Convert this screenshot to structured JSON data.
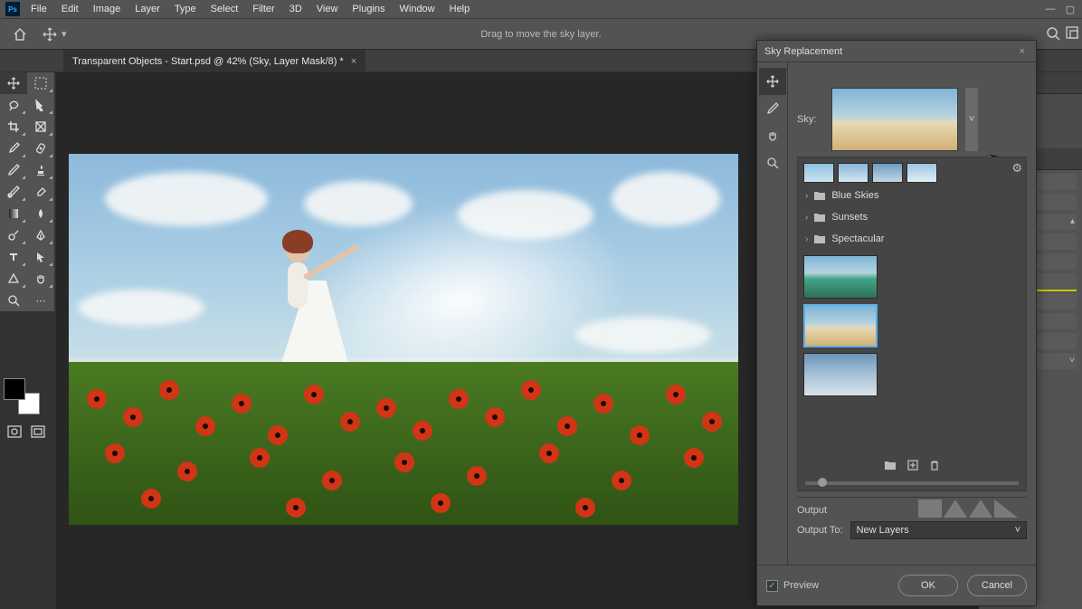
{
  "menubar": {
    "items": [
      "File",
      "Edit",
      "Image",
      "Layer",
      "Type",
      "Select",
      "Filter",
      "3D",
      "View",
      "Plugins",
      "Window",
      "Help"
    ]
  },
  "optionsbar": {
    "hint": "Drag to move the sky layer."
  },
  "document": {
    "tab_title": "Transparent Objects - Start.psd @ 42% (Sky, Layer Mask/8) *"
  },
  "dialog": {
    "title": "Sky Replacement",
    "sky_label": "Sky:",
    "folders": [
      "Blue Skies",
      "Sunsets",
      "Spectacular"
    ],
    "output_header": "Output",
    "output_to_label": "Output To:",
    "output_to_value": "New Layers",
    "preview_label": "Preview",
    "preview_checked": true,
    "ok_label": "OK",
    "cancel_label": "Cancel",
    "picker_icons": {
      "folder": "folder-icon",
      "new": "new-icon",
      "delete": "trash-icon"
    }
  },
  "right_panels": {
    "header1": "",
    "header2": ""
  },
  "colors": {
    "accent": "#5db0e6",
    "ui_bg": "#535353",
    "canvas_bg": "#272727"
  }
}
